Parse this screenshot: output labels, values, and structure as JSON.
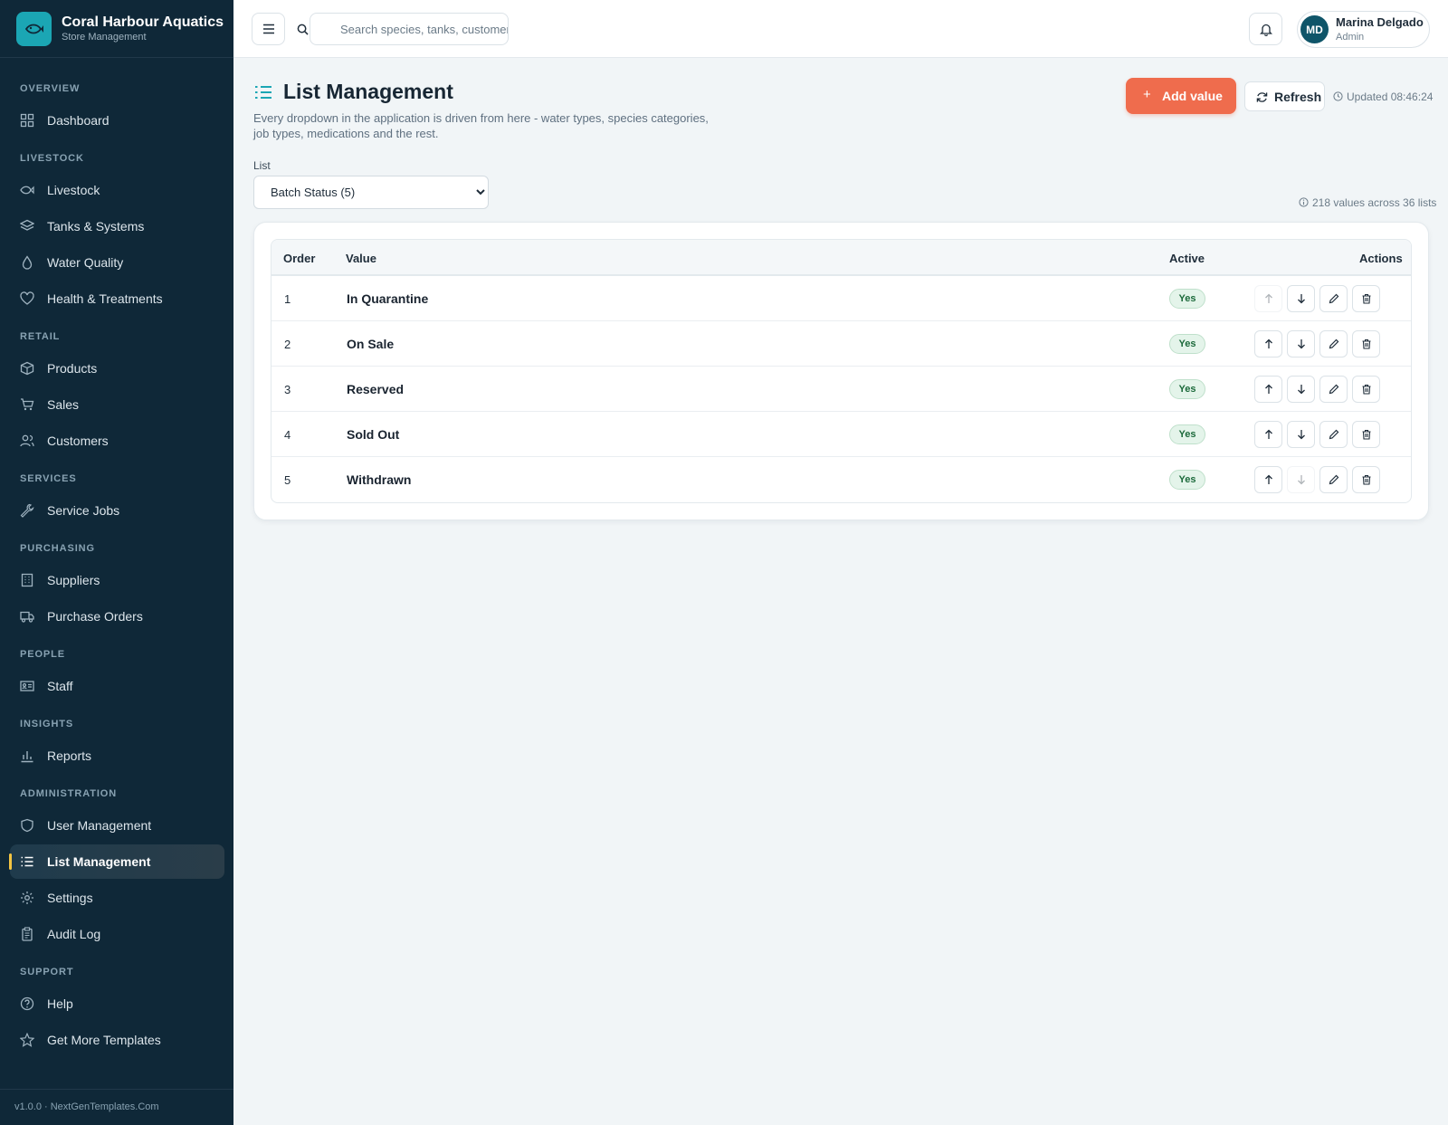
{
  "brand": {
    "name": "Coral Harbour Aquatics",
    "subtitle": "Store Management"
  },
  "nav": {
    "overview": {
      "title": "OVERVIEW",
      "items": [
        {
          "label": "Dashboard"
        }
      ]
    },
    "livestock": {
      "title": "LIVESTOCK",
      "items": [
        {
          "label": "Livestock"
        },
        {
          "label": "Tanks & Systems"
        },
        {
          "label": "Water Quality"
        },
        {
          "label": "Health & Treatments"
        }
      ]
    },
    "retail": {
      "title": "RETAIL",
      "items": [
        {
          "label": "Products"
        },
        {
          "label": "Sales"
        },
        {
          "label": "Customers"
        }
      ]
    },
    "services": {
      "title": "SERVICES",
      "items": [
        {
          "label": "Service Jobs"
        }
      ]
    },
    "purchasing": {
      "title": "PURCHASING",
      "items": [
        {
          "label": "Suppliers"
        },
        {
          "label": "Purchase Orders"
        }
      ]
    },
    "people": {
      "title": "PEOPLE",
      "items": [
        {
          "label": "Staff"
        }
      ]
    },
    "insights": {
      "title": "INSIGHTS",
      "items": [
        {
          "label": "Reports"
        }
      ]
    },
    "administration": {
      "title": "ADMINISTRATION",
      "items": [
        {
          "label": "User Management"
        },
        {
          "label": "List Management"
        },
        {
          "label": "Settings"
        },
        {
          "label": "Audit Log"
        }
      ]
    },
    "support": {
      "title": "SUPPORT",
      "items": [
        {
          "label": "Help"
        },
        {
          "label": "Get More Templates"
        }
      ]
    },
    "active": "List Management"
  },
  "footer": {
    "version": "v1.0.0 · NextGenTemplates.Com"
  },
  "topbar": {
    "search_placeholder": "Search species, tanks, customers...",
    "user": {
      "initials": "MD",
      "name": "Marina Delgado",
      "role": "Admin"
    }
  },
  "page": {
    "title": "List Management",
    "description": "Every dropdown in the application is driven from here - water types, species categories, job types, medications and the rest.",
    "add_label": "Add value",
    "refresh_label": "Refresh",
    "updated": "Updated 08:46:24",
    "list_label": "List",
    "selected_list": "Batch Status (5)",
    "summary": "218 values across 36 lists"
  },
  "table": {
    "headers": {
      "order": "Order",
      "value": "Value",
      "active": "Active",
      "actions": "Actions"
    },
    "rows": [
      {
        "order": "1",
        "value": "In Quarantine",
        "active": "Yes"
      },
      {
        "order": "2",
        "value": "On Sale",
        "active": "Yes"
      },
      {
        "order": "3",
        "value": "Reserved",
        "active": "Yes"
      },
      {
        "order": "4",
        "value": "Sold Out",
        "active": "Yes"
      },
      {
        "order": "5",
        "value": "Withdrawn",
        "active": "Yes"
      }
    ]
  },
  "colors": {
    "sidebar": "#0f2838",
    "accent": "#ef6c4d",
    "brand": "#1ba6b4",
    "active_marker": "#f4c542"
  }
}
